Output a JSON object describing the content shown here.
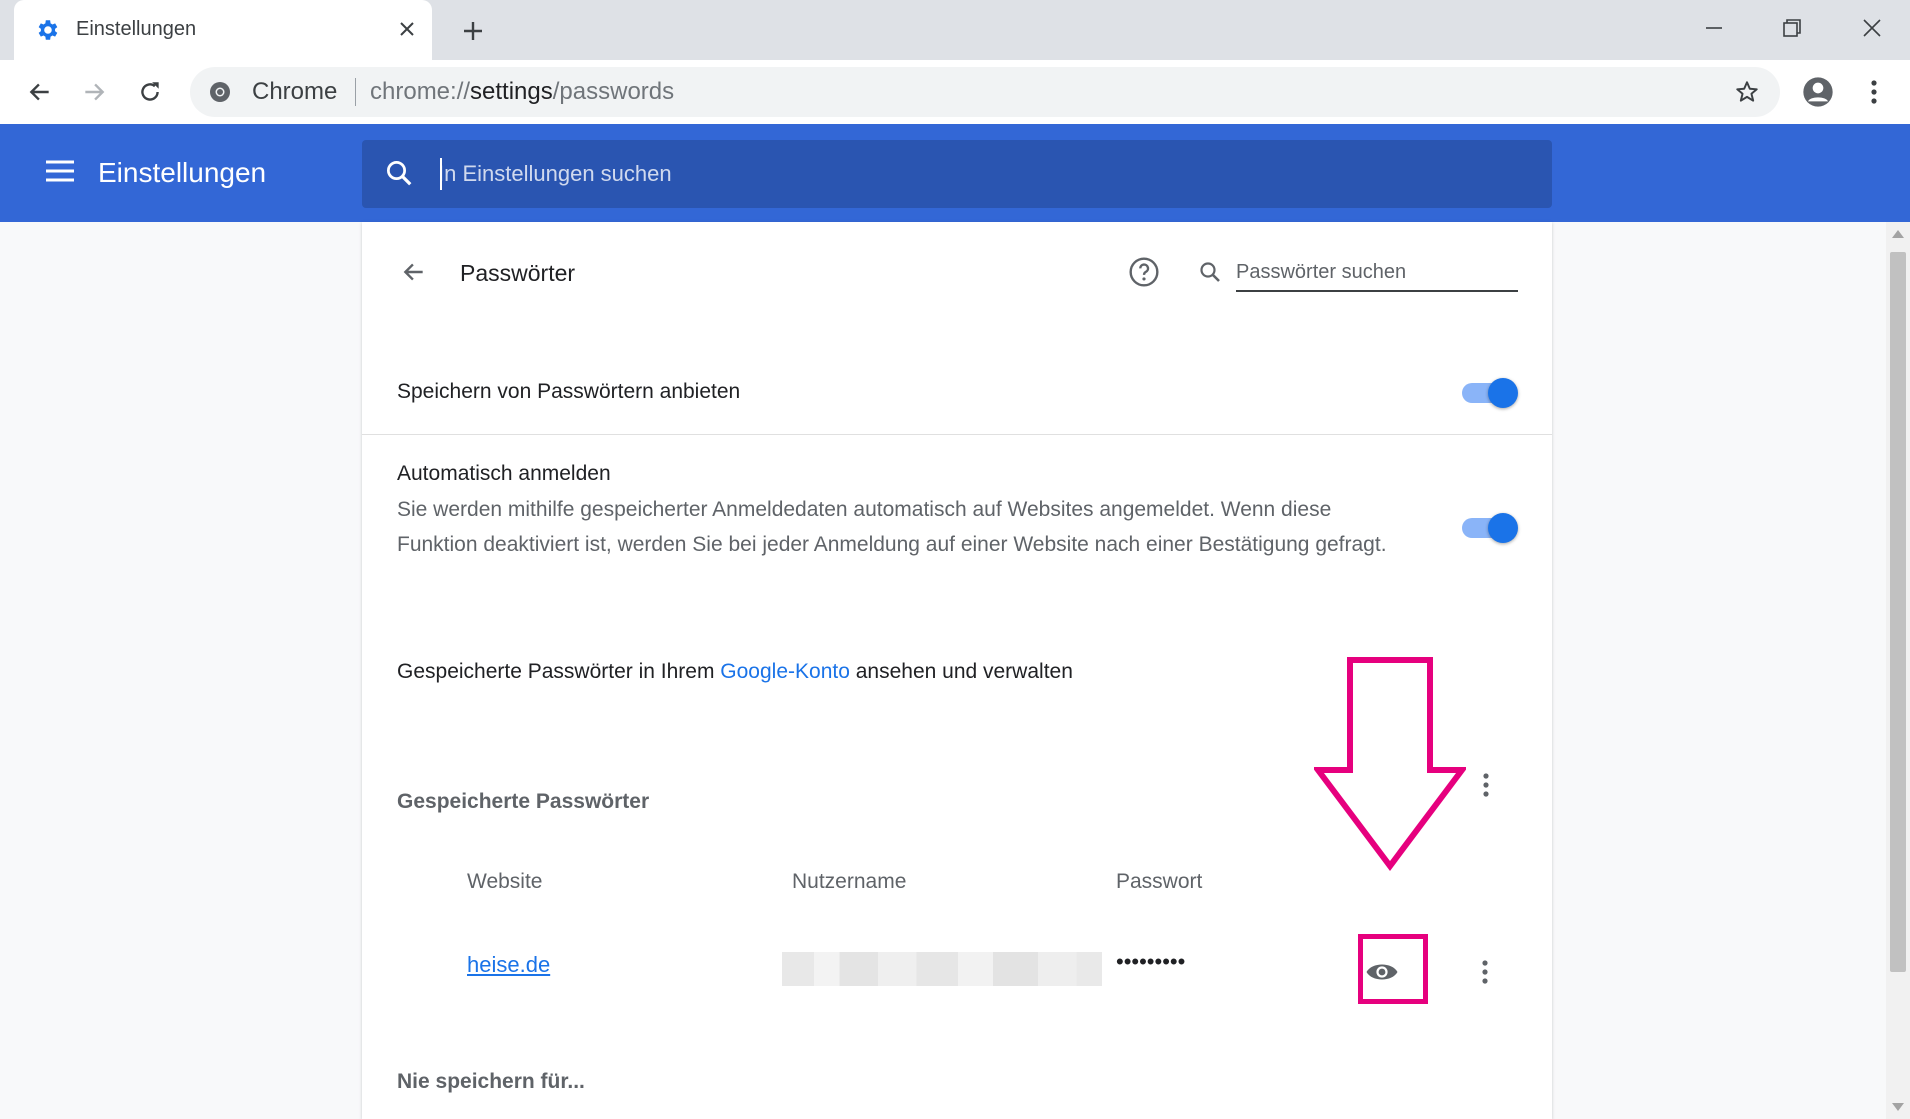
{
  "browser": {
    "tab_title": "Einstellungen",
    "omnibox_label": "Chrome",
    "url_scheme": "chrome://",
    "url_host": "settings",
    "url_path": "/passwords"
  },
  "settings_header": {
    "title": "Einstellungen",
    "search_placeholder": "In Einstellungen suchen"
  },
  "passwords_page": {
    "title": "Passwörter",
    "search_placeholder": "Passwörter suchen",
    "offer_to_save": {
      "label": "Speichern von Passwörtern anbieten",
      "enabled": true
    },
    "auto_signin": {
      "label": "Automatisch anmelden",
      "description": "Sie werden mithilfe gespeicherter Anmeldedaten automatisch auf Websites angemeldet. Wenn diese Funktion deaktiviert ist, werden Sie bei jeder Anmeldung auf einer Website nach einer Bestätigung gefragt.",
      "enabled": true
    },
    "google_account": {
      "text_before": "Gespeicherte Passwörter in Ihrem ",
      "link": "Google-Konto",
      "text_after": " ansehen und verwalten"
    },
    "saved_passwords": {
      "heading": "Gespeicherte Passwörter",
      "columns": [
        "Website",
        "Nutzername",
        "Passwort"
      ],
      "rows": [
        {
          "website": "heise.de",
          "username": "",
          "password": "•••••••••"
        }
      ]
    },
    "never_saved": {
      "heading": "Nie speichern für..."
    }
  },
  "colors": {
    "header_blue": "#3367d6",
    "search_blue": "#2a55b1",
    "link_blue": "#1a73e8",
    "annotation_pink": "#e6007e"
  },
  "icons": [
    "gear-icon",
    "close-icon",
    "plus-icon",
    "back-icon",
    "forward-icon",
    "reload-icon",
    "chrome-icon",
    "star-icon",
    "account-icon",
    "kebab-icon",
    "hamburger-icon",
    "search-icon",
    "help-icon",
    "eye-icon",
    "arrow-down-annotation"
  ]
}
